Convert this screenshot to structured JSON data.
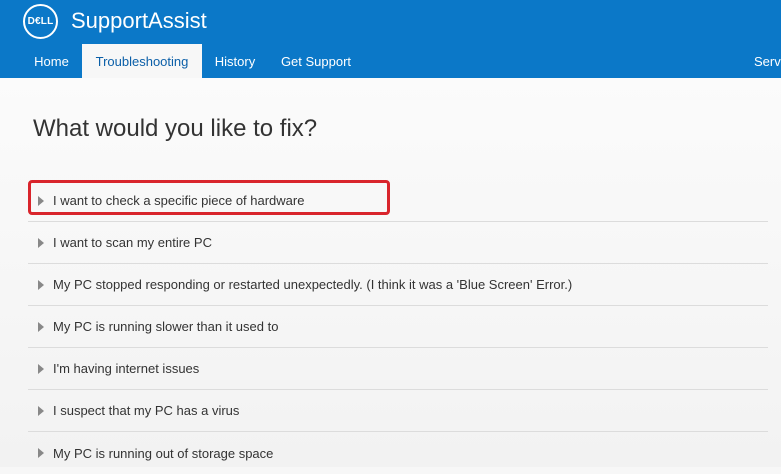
{
  "app": {
    "title": "SupportAssist",
    "logo_text": "D€LL"
  },
  "nav": {
    "tabs": [
      {
        "label": "Home"
      },
      {
        "label": "Troubleshooting"
      },
      {
        "label": "History"
      },
      {
        "label": "Get Support"
      },
      {
        "label": "Serv"
      }
    ],
    "active_tab": "Troubleshooting"
  },
  "main": {
    "title": "What would you like to fix?",
    "items": [
      {
        "label": "I want to check a specific piece of hardware"
      },
      {
        "label": "I want to scan my entire PC"
      },
      {
        "label": "My PC stopped responding or restarted unexpectedly. (I think it was a 'Blue Screen' Error.)"
      },
      {
        "label": "My PC is running slower than it used to"
      },
      {
        "label": "I'm having internet issues"
      },
      {
        "label": "I suspect that my PC has a virus"
      },
      {
        "label": "My PC is running out of storage space"
      }
    ]
  },
  "colors": {
    "header": "#0b78c8",
    "highlight": "#d9252c"
  }
}
